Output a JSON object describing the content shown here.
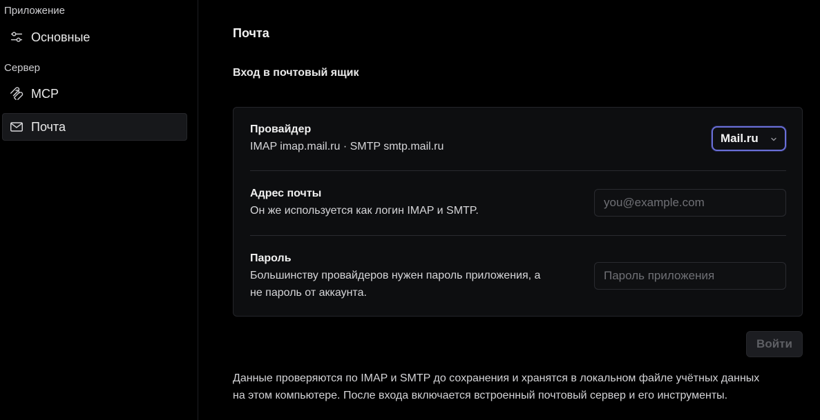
{
  "sidebar": {
    "sections": [
      {
        "title": "Приложение",
        "items": [
          {
            "label": "Основные",
            "icon": "sliders-icon",
            "active": false
          }
        ]
      },
      {
        "title": "Сервер",
        "items": [
          {
            "label": "MCP",
            "icon": "mcp-icon",
            "active": false
          },
          {
            "label": "Почта",
            "icon": "mail-icon",
            "active": true
          }
        ]
      }
    ]
  },
  "main": {
    "title": "Почта",
    "section_title": "Вход в почтовый ящик",
    "provider": {
      "label": "Провайдер",
      "description": "IMAP imap.mail.ru · SMTP smtp.mail.ru",
      "selected": "Mail.ru"
    },
    "email": {
      "label": "Адрес почты",
      "description": "Он же используется как логин IMAP и SMTP.",
      "value": "",
      "placeholder": "you@example.com"
    },
    "password": {
      "label": "Пароль",
      "description_line1": "Большинству провайдеров нужен пароль приложения, а",
      "description_line2": "не пароль от аккаунта.",
      "value": "",
      "placeholder": "Пароль приложения"
    },
    "login_button": "Войти",
    "footer_line1": "Данные проверяются по IMAP и SMTP до сохранения и хранятся в локальном файле учётных данных",
    "footer_line2": "на этом компьютере. После входа включается встроенный почтовый сервер и его инструменты."
  },
  "colors": {
    "background": "#000000",
    "card": "#0d0e10",
    "accent_focus": "#6a6fd8",
    "disabled_text": "#5e5f64"
  }
}
